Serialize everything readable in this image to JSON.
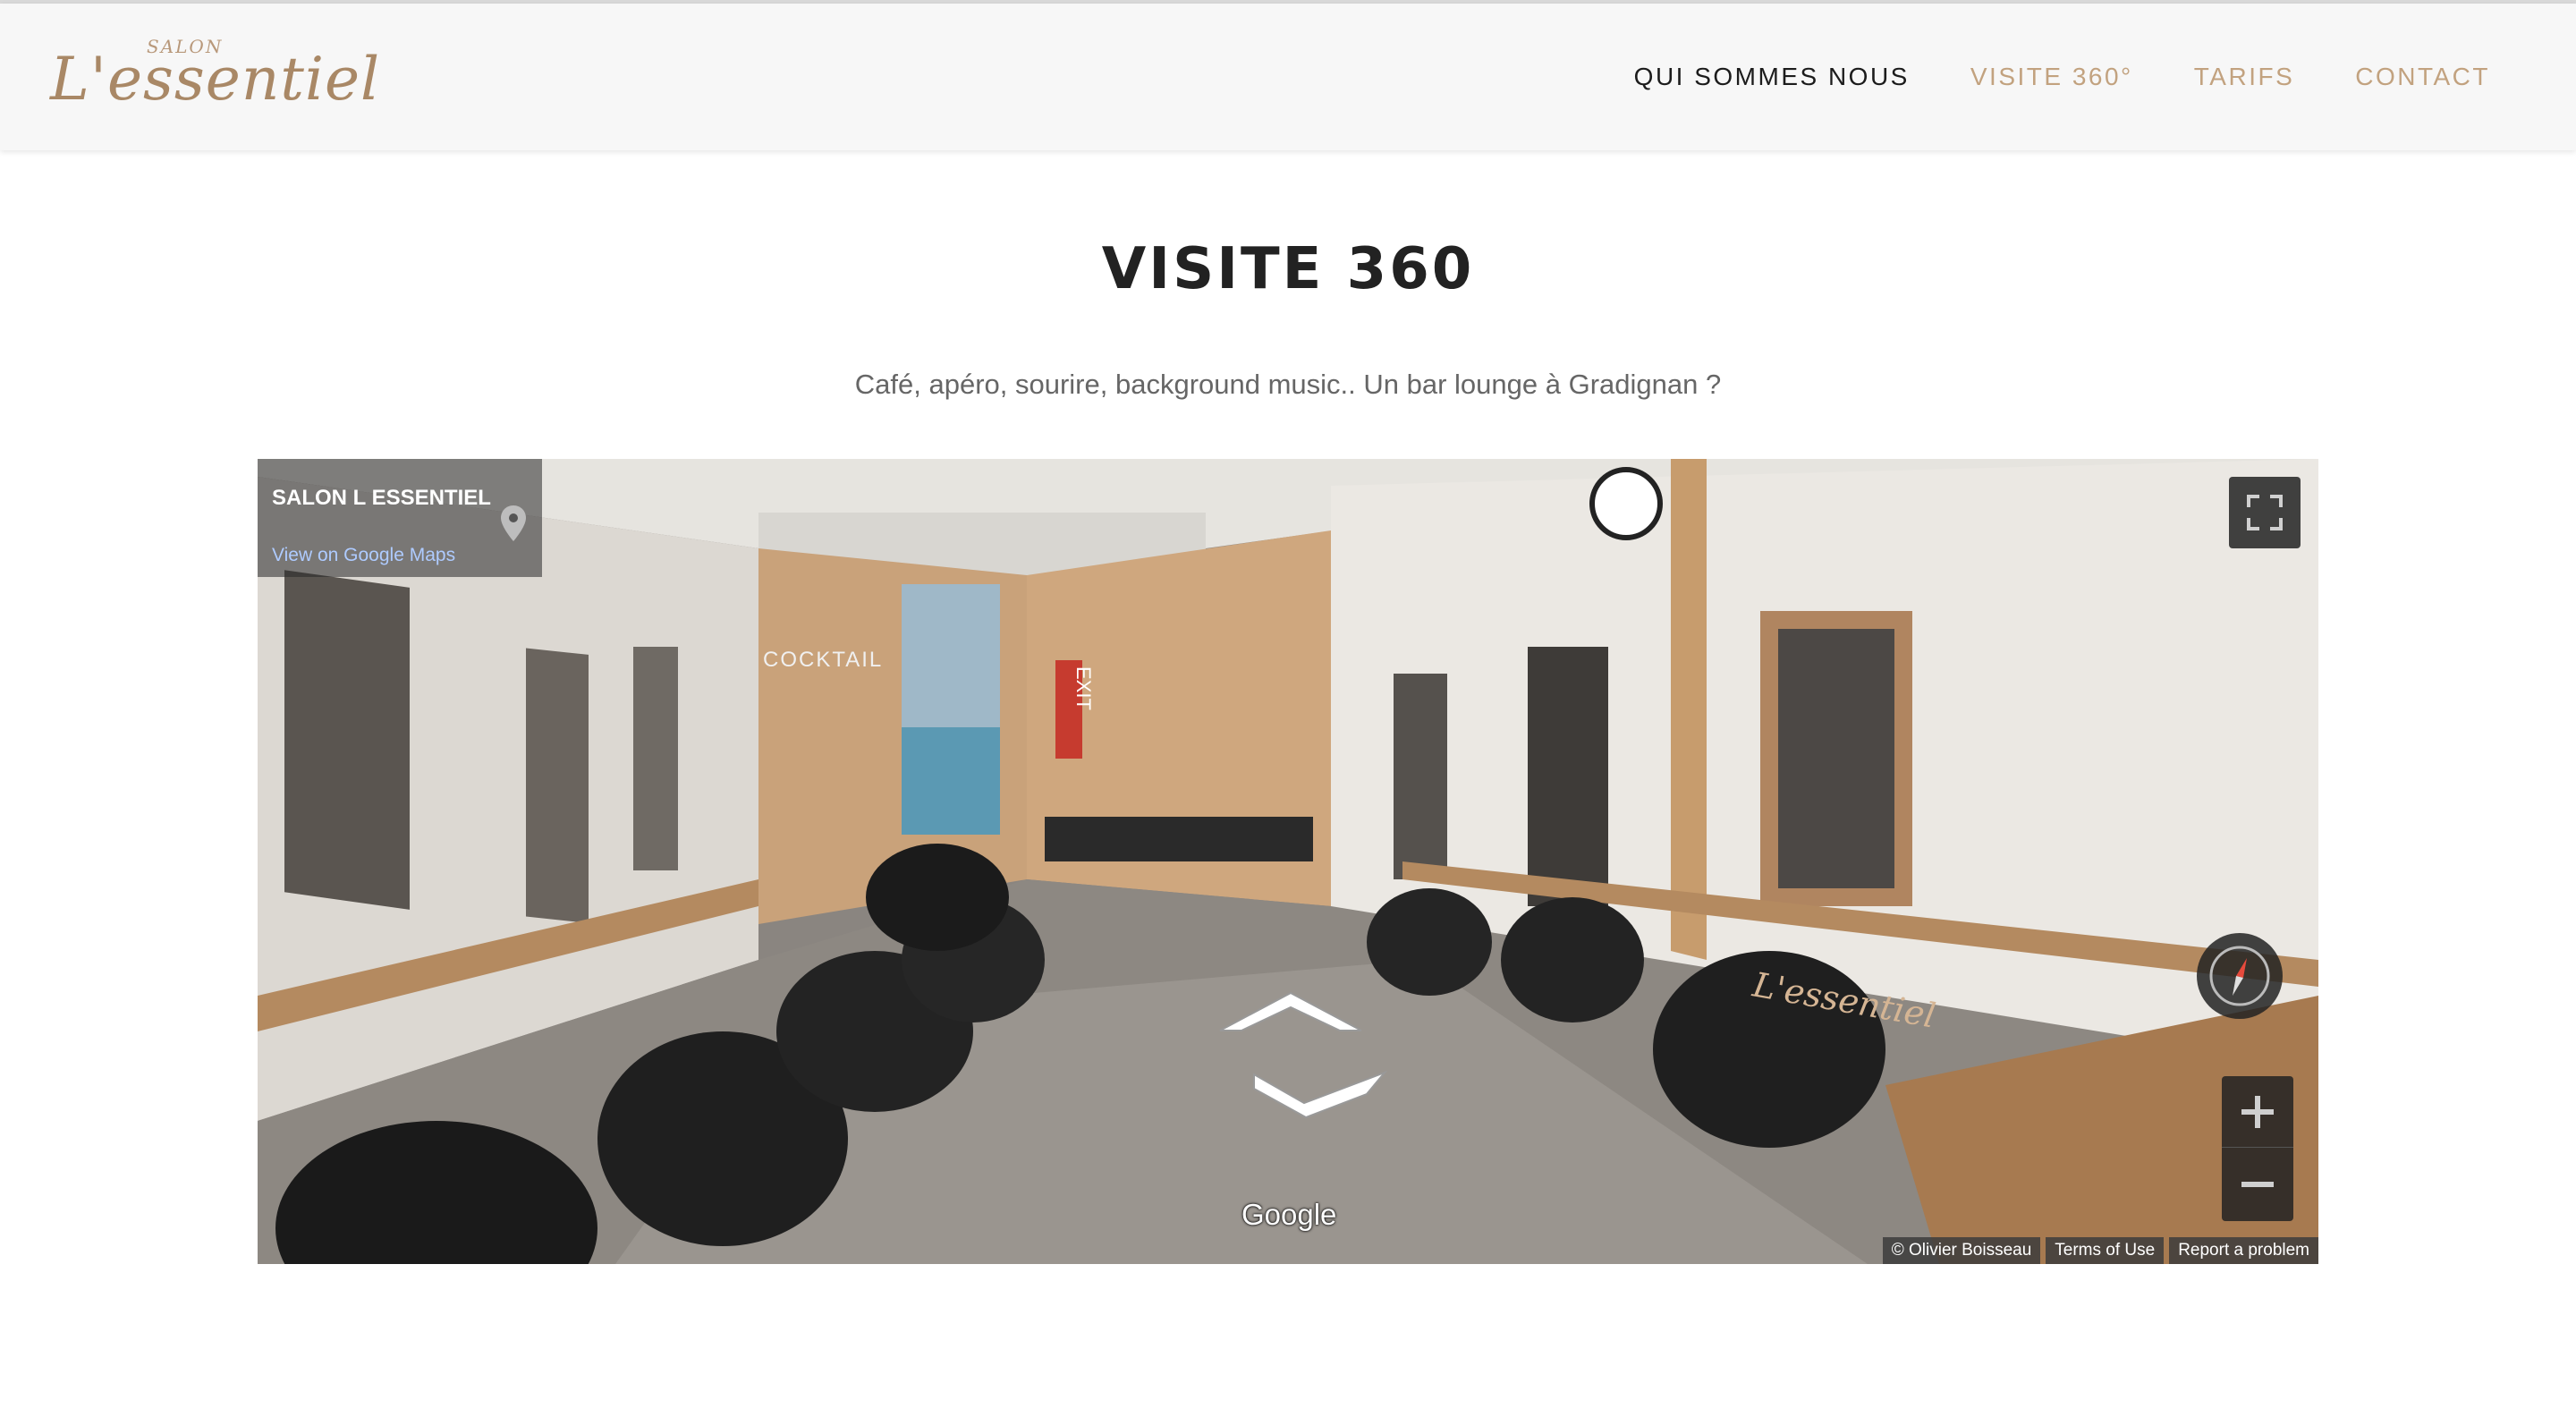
{
  "header": {
    "logo_small": "SALON",
    "logo_main": "L'essentiel",
    "nav": [
      {
        "label": "QUI SOMMES NOUS"
      },
      {
        "label": "VISITE 360°"
      },
      {
        "label": "TARIFS"
      },
      {
        "label": "CONTACT"
      }
    ]
  },
  "main": {
    "title": "VISITE 360",
    "subtitle": "Café, apéro, sourire, background music.. Un bar lounge à Gradignan ?"
  },
  "streetview": {
    "place_name": "SALON L ESSENTIEL",
    "maps_link": "View on Google Maps",
    "google_logo": "Google",
    "footer": [
      "© Olivier Boisseau",
      "Terms of Use",
      "Report a problem"
    ],
    "scene_text": {
      "cocktail_sign": "COCKTAIL",
      "exit_sign": "EXIT",
      "wall_logo": "L'essentiel"
    },
    "icons": [
      "pin-icon",
      "fullscreen-icon",
      "compass-icon",
      "plus-icon",
      "minus-icon",
      "chevron-up-icon",
      "chevron-down-icon"
    ]
  },
  "colors": {
    "accent": "#c2a27f",
    "nav_active_dark": "#1c1c1c",
    "header_bg": "#f7f7f7"
  }
}
